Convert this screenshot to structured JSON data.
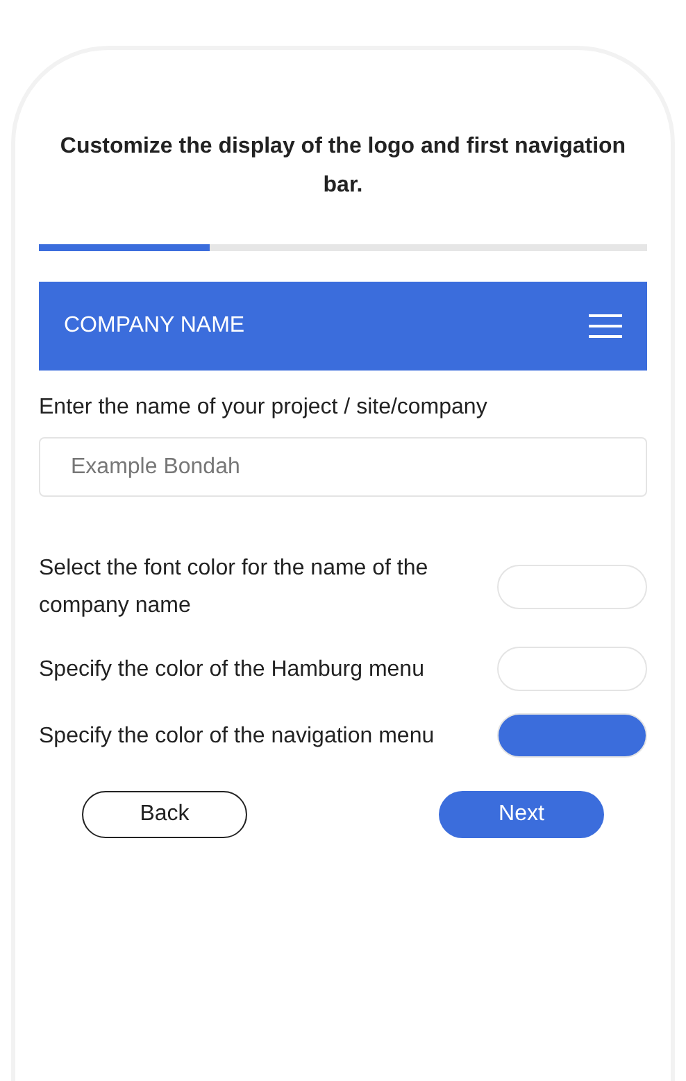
{
  "heading": "Customize the display of the logo and first navigation bar.",
  "progress": {
    "level": 0.28
  },
  "preview_nav": {
    "company_name": "COMPANY NAME"
  },
  "name_field": {
    "label": "Enter the name of your project / site/company",
    "placeholder": "Example Bondah"
  },
  "color_options": [
    {
      "label": "Select the font color for the name of the company name",
      "color": "#ffffff"
    },
    {
      "label": "Specify the color of the Hamburg menu",
      "color": "#ffffff"
    },
    {
      "label": "Specify the color of the navigation menu",
      "color": "#3b6ddc"
    }
  ],
  "buttons": {
    "back": "Back",
    "next": "Next"
  }
}
